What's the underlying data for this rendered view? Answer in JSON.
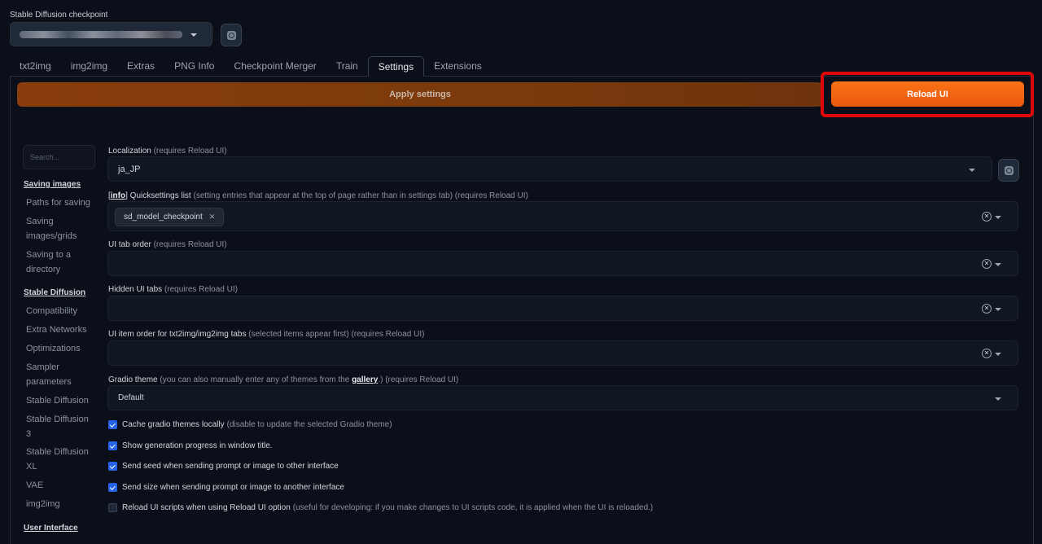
{
  "checkpoint": {
    "label": "Stable Diffusion checkpoint"
  },
  "tabs": [
    "txt2img",
    "img2img",
    "Extras",
    "PNG Info",
    "Checkpoint Merger",
    "Train",
    "Settings",
    "Extensions"
  ],
  "buttons": {
    "apply": "Apply settings",
    "reload": "Reload UI"
  },
  "search_placeholder": "Search...",
  "sidebar": [
    {
      "label": "Saving images",
      "head": true
    },
    {
      "label": "Paths for saving"
    },
    {
      "label": "Saving images/grids"
    },
    {
      "label": "Saving to a directory"
    },
    {
      "label": "Stable Diffusion",
      "head": true
    },
    {
      "label": "Compatibility"
    },
    {
      "label": "Extra Networks"
    },
    {
      "label": "Optimizations"
    },
    {
      "label": "Sampler parameters"
    },
    {
      "label": "Stable Diffusion"
    },
    {
      "label": "Stable Diffusion 3"
    },
    {
      "label": "Stable Diffusion XL"
    },
    {
      "label": "VAE"
    },
    {
      "label": "img2img"
    },
    {
      "label": "User Interface",
      "head": true
    }
  ],
  "settings": {
    "localization": {
      "label": "Localization",
      "note": "(requires Reload UI)",
      "value": "ja_JP"
    },
    "quicksettings": {
      "info": "info",
      "label": "Quicksettings list",
      "note": "(setting entries that appear at the top of page rather than in settings tab) (requires Reload UI)",
      "token": "sd_model_checkpoint"
    },
    "tab_order": {
      "label": "UI tab order",
      "note": "(requires Reload UI)"
    },
    "hidden_tabs": {
      "label": "Hidden UI tabs",
      "note": "(requires Reload UI)"
    },
    "item_order": {
      "label": "UI item order for txt2img/img2img tabs",
      "note": "(selected items appear first) (requires Reload UI)"
    },
    "gradio_theme": {
      "label": "Gradio theme",
      "note_pre": "(you can also manually enter any of themes from the",
      "link": "gallery",
      "note_post": ".) (requires Reload UI)",
      "value": "Default"
    }
  },
  "checkboxes": [
    {
      "label": "Cache gradio themes locally",
      "note": "(disable to update the selected Gradio theme)",
      "checked": true
    },
    {
      "label": "Show generation progress in window title.",
      "note": "",
      "checked": true
    },
    {
      "label": "Send seed when sending prompt or image to other interface",
      "note": "",
      "checked": true
    },
    {
      "label": "Send size when sending prompt or image to another interface",
      "note": "",
      "checked": true
    },
    {
      "label": "Reload UI scripts when using Reload UI option",
      "note": "(useful for developing: if you make changes to UI scripts code, it is applied when the UI is reloaded.)",
      "checked": false
    }
  ],
  "colors": {
    "accent": "#f97316",
    "highlight": "#dc0a0a",
    "checkbox": "#2563eb"
  }
}
